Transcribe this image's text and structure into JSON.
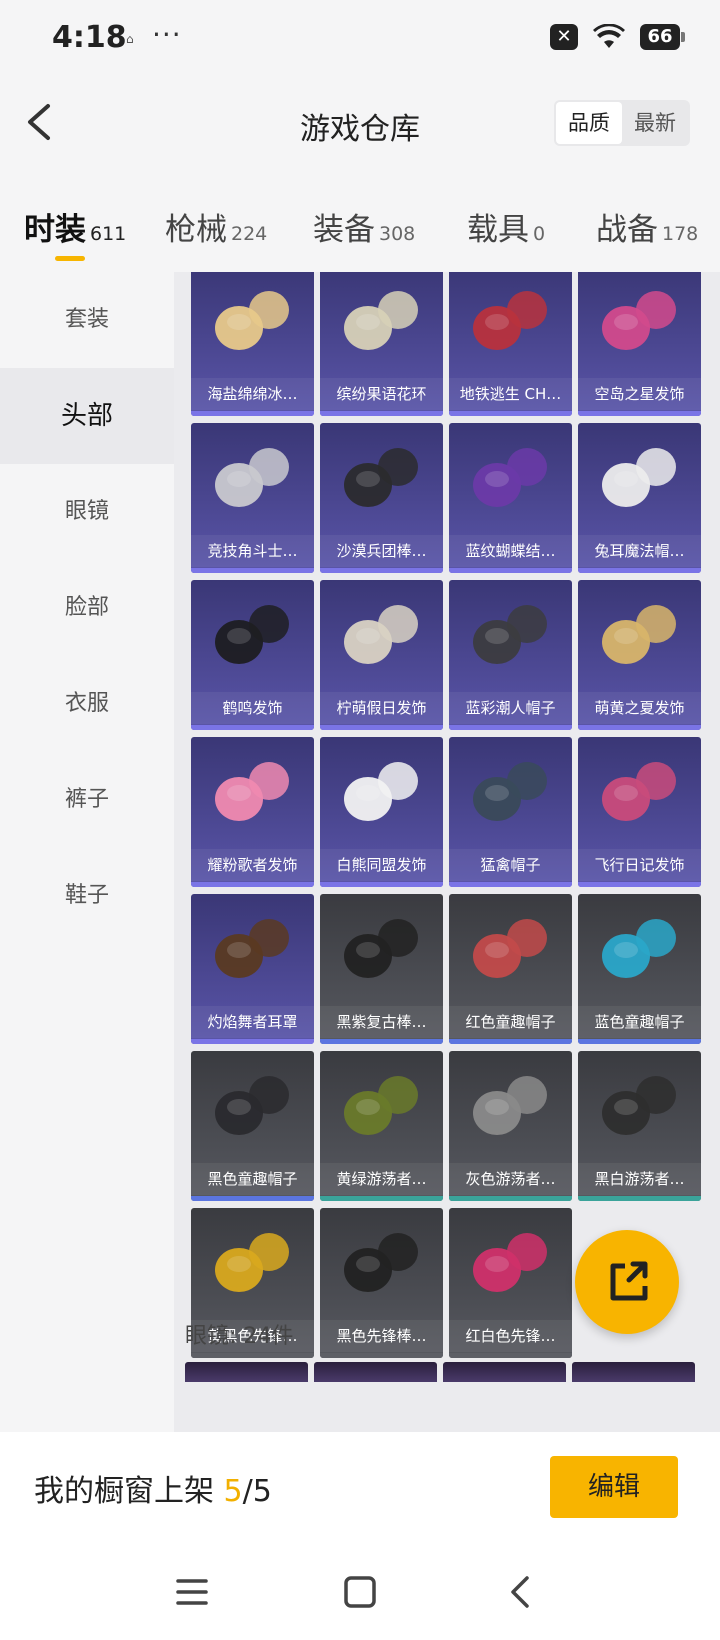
{
  "status_bar": {
    "time": "4:18",
    "small_icon": "⌂",
    "dots": "···",
    "x_icon": "✕",
    "wifi_icon": "wifi-icon",
    "battery": "66"
  },
  "header": {
    "title": "游戏仓库",
    "seg_quality": "品质",
    "seg_newest": "最新"
  },
  "tabs": [
    {
      "label": "时装",
      "count": "611"
    },
    {
      "label": "枪械",
      "count": "224"
    },
    {
      "label": "装备",
      "count": "308"
    },
    {
      "label": "载具",
      "count": "0"
    },
    {
      "label": "战备",
      "count": "178"
    }
  ],
  "sidebar": [
    "套装",
    "头部",
    "眼镜",
    "脸部",
    "衣服",
    "裤子",
    "鞋子"
  ],
  "items": [
    {
      "name": "海盐绵绵冰…",
      "style": "purple"
    },
    {
      "name": "缤纷果语花环",
      "style": "purple"
    },
    {
      "name": "地铁逃生 CH…",
      "style": "purple"
    },
    {
      "name": "空岛之星发饰",
      "style": "purple"
    },
    {
      "name": "竞技角斗士…",
      "style": "purple"
    },
    {
      "name": "沙漠兵团棒…",
      "style": "purple"
    },
    {
      "name": "蓝纹蝴蝶结…",
      "style": "purple"
    },
    {
      "name": "兔耳魔法帽…",
      "style": "purple"
    },
    {
      "name": "鹤鸣发饰",
      "style": "purple"
    },
    {
      "name": "柠萌假日发饰",
      "style": "purple"
    },
    {
      "name": "蓝彩潮人帽子",
      "style": "purple"
    },
    {
      "name": "萌黄之夏发饰",
      "style": "purple"
    },
    {
      "name": "耀粉歌者发饰",
      "style": "purple"
    },
    {
      "name": "白熊同盟发饰",
      "style": "purple"
    },
    {
      "name": "猛禽帽子",
      "style": "purple"
    },
    {
      "name": "飞行日记发饰",
      "style": "purple"
    },
    {
      "name": "灼焰舞者耳罩",
      "style": "purple"
    },
    {
      "name": "黑紫复古棒…",
      "style": "gray bar-blue"
    },
    {
      "name": "红色童趣帽子",
      "style": "gray bar-blue"
    },
    {
      "name": "蓝色童趣帽子",
      "style": "gray bar-blue"
    },
    {
      "name": "黑色童趣帽子",
      "style": "gray bar-blue"
    },
    {
      "name": "黄绿游荡者…",
      "style": "gray bar-teal"
    },
    {
      "name": "灰色游荡者…",
      "style": "gray bar-teal"
    },
    {
      "name": "黑白游荡者…",
      "style": "gray bar-teal"
    },
    {
      "name": "黄黑色先锋…",
      "style": "gray"
    },
    {
      "name": "黑色先锋棒…",
      "style": "gray"
    },
    {
      "name": "红白色先锋…",
      "style": "gray"
    }
  ],
  "section_next": "眼镜: 24件",
  "shop": {
    "label": "我的橱窗上架 ",
    "count": "5",
    "total": "/5",
    "edit": "编辑"
  },
  "colors": {
    "accent": "#f8b400",
    "purple_card": "#4a4690",
    "gray_card": "#4a4b50"
  }
}
